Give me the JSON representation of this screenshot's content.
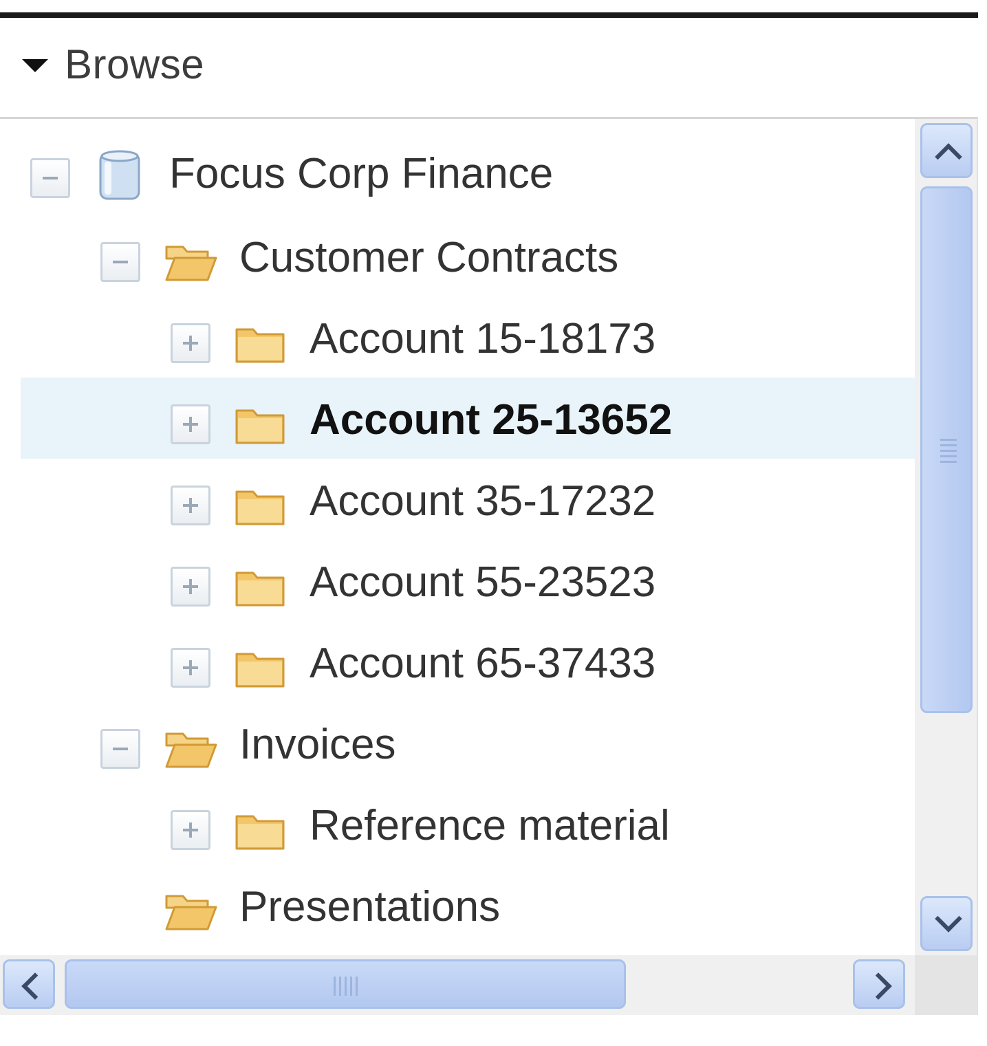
{
  "browse": {
    "title": "Browse",
    "caret_icon": "caret-down-icon"
  },
  "tree": {
    "nodes": [
      {
        "label": "Focus Corp Finance",
        "icon": "database-icon",
        "toggle": "collapse",
        "selected": false
      },
      {
        "label": "Customer Contracts",
        "icon": "folder-open-icon",
        "toggle": "collapse",
        "selected": false
      },
      {
        "label": "Account 15-18173",
        "icon": "folder-icon",
        "toggle": "expand",
        "selected": false
      },
      {
        "label": "Account 25-13652",
        "icon": "folder-icon",
        "toggle": "expand",
        "selected": true
      },
      {
        "label": "Account 35-17232",
        "icon": "folder-icon",
        "toggle": "expand",
        "selected": false
      },
      {
        "label": "Account 55-23523",
        "icon": "folder-icon",
        "toggle": "expand",
        "selected": false
      },
      {
        "label": "Account 65-37433",
        "icon": "folder-icon",
        "toggle": "expand",
        "selected": false
      },
      {
        "label": "Invoices",
        "icon": "folder-open-icon",
        "toggle": "collapse",
        "selected": false
      },
      {
        "label": "Reference material",
        "icon": "folder-icon",
        "toggle": "expand",
        "selected": false
      },
      {
        "label": "Presentations",
        "icon": "folder-open-icon",
        "toggle": "none",
        "selected": false
      }
    ]
  },
  "scrollbars": {
    "vertical": {
      "up_icon": "chevron-up-icon",
      "down_icon": "chevron-down-icon"
    },
    "horizontal": {
      "left_icon": "chevron-left-icon",
      "right_icon": "chevron-right-icon"
    }
  },
  "colors": {
    "selected_row": "#e8f3fa",
    "scroll_thumb": "#b9cdf2",
    "folder": "#f3c769"
  }
}
